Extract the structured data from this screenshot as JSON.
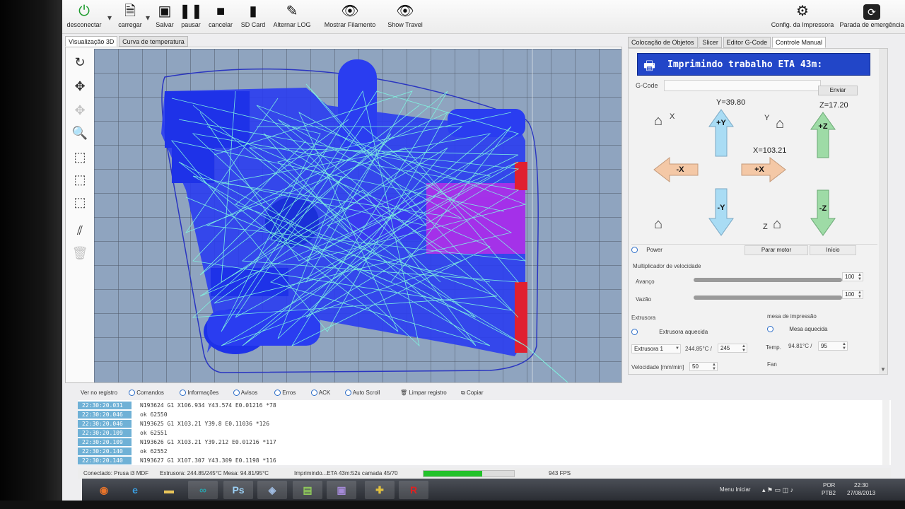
{
  "toolbar": {
    "buttons": [
      {
        "label": "desconectar",
        "icon": "power-icon"
      },
      {
        "label": "carregar",
        "icon": "document-icon"
      },
      {
        "label": "Salvar",
        "icon": "floppy-icon"
      },
      {
        "label": "pausar",
        "icon": "pause-icon"
      },
      {
        "label": "cancelar",
        "icon": "stop-icon"
      },
      {
        "label": "SD Card",
        "icon": "sd-card-icon"
      },
      {
        "label": "Alternar LOG",
        "icon": "pen-icon"
      },
      {
        "label": "Mostrar Filamento",
        "icon": "eye-icon"
      },
      {
        "label": "Show Travel",
        "icon": "eye-icon"
      }
    ],
    "right_buttons": [
      {
        "label": "Config. da Impressora",
        "icon": "gears-icon"
      },
      {
        "label": "Parada de emergência",
        "icon": "emergency-icon"
      }
    ]
  },
  "left_tabs": [
    "Visualização 3D",
    "Curva de temperatura"
  ],
  "right_tabs": [
    "Colocação de Objetos",
    "Slicer",
    "Editor G-Code",
    "Controle Manual"
  ],
  "manual": {
    "banner": "Imprimindo trabalho ETA 43m:",
    "gcode_label": "G-Code",
    "send_label": "Enviar",
    "y_coord": "Y=39.80",
    "x_coord": "X=103.21",
    "z_coord": "Z=17.20",
    "label_x": "X",
    "label_y": "Y",
    "label_z": "Z",
    "jog_plus_y": "+Y",
    "jog_minus_y": "-Y",
    "jog_plus_x": "+X",
    "jog_minus_x": "-X",
    "jog_plus_z": "+Z",
    "jog_minus_z": "-Z",
    "power_label": "Power",
    "stop_motor": "Parar motor",
    "home_label": "Início",
    "speed_multiplier": "Multiplicador de velocidade",
    "feed_label": "Avanço",
    "feed_value": "100",
    "feed_level": 1.0,
    "flow_label": "Vazão",
    "flow_value": "100",
    "flow_level": 1.0,
    "extruder_section": "Extrusora",
    "heated_extruder": "Extrusora aquecida",
    "bed_section": "mesa de impressão",
    "heated_bed": "Mesa aquecida",
    "extruder_select": "Extrusora 1",
    "extruder_temp": "244.85°C /",
    "extruder_target": "245",
    "bed_temp_label": "Temp.",
    "bed_temp": "94.81°C /",
    "bed_target": "95",
    "speed_label": "Velocidade [mm/min]",
    "speed_value": "50",
    "fan_label": "Fan"
  },
  "log": {
    "filters": [
      "Ver no registro",
      "Comandos",
      "Informações",
      "Avisos",
      "Erros",
      "ACK",
      "Auto Scroll",
      "Limpar registro",
      "Copiar"
    ],
    "lines": [
      {
        "ts": "22:30:20.031",
        "msg": "N193624 G1 X106.934 Y43.574 E0.01216 *78"
      },
      {
        "ts": "22:30:20.046",
        "msg": "ok 62550"
      },
      {
        "ts": "22:30:20.046",
        "msg": "N193625 G1 X103.21 Y39.8 E0.11036 *126"
      },
      {
        "ts": "22:30:20.109",
        "msg": "ok 62551"
      },
      {
        "ts": "22:30:20.109",
        "msg": "N193626 G1 X103.21 Y39.212 E0.01216 *117"
      },
      {
        "ts": "22:30:20.140",
        "msg": "ok 62552"
      },
      {
        "ts": "22:30:20.140",
        "msg": "N193627 G1 X107.307 Y43.309 E0.1198 *116"
      }
    ]
  },
  "status": {
    "connected": "Conectado: Prusa i3 MDF",
    "temps": "Extrusora: 244.85/245°C Mesa: 94.81/95°C",
    "printing": "Imprimindo...ETA 43m:52s camada 45/70",
    "progress": 0.65,
    "fps": "943 FPS"
  },
  "taskbar": {
    "apps": [
      {
        "name": "firefox-icon",
        "glyph": "◉",
        "color": "#e8742a"
      },
      {
        "name": "ie-icon",
        "glyph": "e",
        "color": "#3a9de0"
      },
      {
        "name": "explorer-icon",
        "glyph": "▬",
        "color": "#e8c45a"
      },
      {
        "name": "arduino-icon",
        "glyph": "∞",
        "color": "#2aa0a8"
      },
      {
        "name": "photoshop-icon",
        "glyph": "Ps",
        "color": "#9bd0f5"
      },
      {
        "name": "cube-icon",
        "glyph": "◈",
        "color": "#9fbbe0"
      },
      {
        "name": "notepad-icon",
        "glyph": "▤",
        "color": "#8fc95a"
      },
      {
        "name": "app-icon",
        "glyph": "▣",
        "color": "#a58ad8"
      },
      {
        "name": "puzzle-icon",
        "glyph": "✚",
        "color": "#e0c040"
      },
      {
        "name": "repetier-icon",
        "glyph": "R",
        "color": "#e02020"
      }
    ],
    "start_menu": "Menu Iniciar",
    "lang": "POR",
    "lang2": "PTB2",
    "time": "22:30",
    "date": "27/08/2013"
  },
  "colors": {
    "accent": "#2246c8",
    "model_blue": "#2a3df0",
    "travel_lines": "#7ff5e0",
    "magenta": "#c030e0",
    "progress": "#22c22a"
  }
}
